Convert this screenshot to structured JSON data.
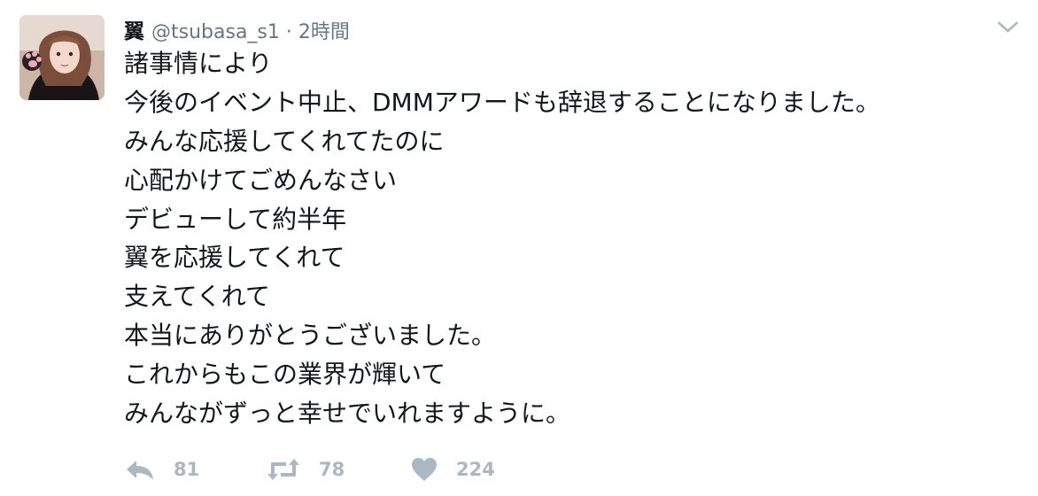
{
  "tweet": {
    "display_name": "翼",
    "handle": "@tsubasa_s1",
    "separator": "·",
    "time": "2時間",
    "body_lines": [
      "諸事情により",
      "今後のイベント中止、DMMアワードも辞退することになりました。",
      "みんな応援してくれてたのに",
      "心配かけてごめんなさい",
      "デビューして約半年",
      "翼を応援してくれて",
      "支えてくれて",
      "本当にありがとうございました。",
      "これからもこの業界が輝いて",
      "みんながずっと幸せでいれますように。"
    ],
    "actions": {
      "reply_count": "81",
      "retweet_count": "78",
      "like_count": "224"
    }
  },
  "colors": {
    "text": "#14171a",
    "secondary": "#657786",
    "icon": "#aab8c2"
  },
  "icons": {
    "reply": "reply-icon",
    "retweet": "retweet-icon",
    "like": "heart-icon",
    "menu": "chevron-down-icon"
  }
}
